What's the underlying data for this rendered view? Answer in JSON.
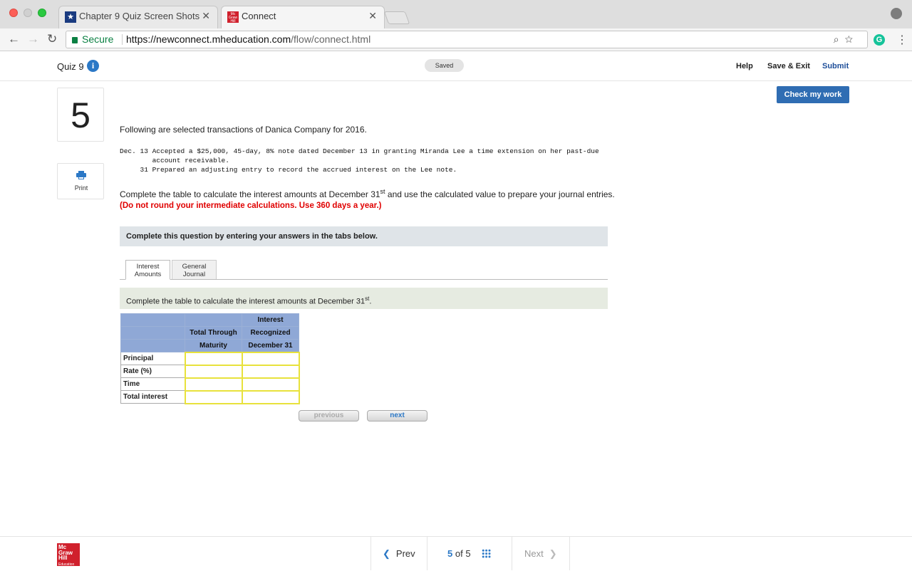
{
  "browser": {
    "tabs": [
      {
        "title": "Chapter 9 Quiz Screen Shots"
      },
      {
        "title": "Connect"
      }
    ],
    "secure_label": "Secure",
    "url_host": "https://newconnect.mheducation.com",
    "url_path": "/flow/connect.html",
    "extension_letter": "G"
  },
  "header": {
    "quiz_title": "Quiz 9",
    "saved_label": "Saved",
    "help": "Help",
    "save_exit": "Save & Exit",
    "submit": "Submit",
    "check_work": "Check my work"
  },
  "question": {
    "number": "5",
    "print_label": "Print",
    "intro": "Following are selected transactions of Danica Company for 2016.",
    "transactions": "Dec. 13 Accepted a $25,000, 45-day, 8% note dated December 13 in granting Miranda Lee a time extension on her past-due\n        account receivable.\n     31 Prepared an adjusting entry to record the accrued interest on the Lee note.",
    "instruction_pre": "Complete the table to calculate the interest amounts at December 31",
    "instruction_sup": "st",
    "instruction_post": " and use the calculated value to prepare your journal entries.",
    "warning": "(Do not round your intermediate calculations. Use 360 days a year.)",
    "banner": "Complete this question by entering your answers in the tabs below.",
    "tabs": [
      {
        "line1": "Interest",
        "line2": "Amounts"
      },
      {
        "line1": "General",
        "line2": "Journal"
      }
    ],
    "sub_banner_pre": "Complete the table to calculate the interest amounts at December 31",
    "sub_banner_sup": "st",
    "sub_banner_post": "."
  },
  "table": {
    "headers": {
      "col1": [
        "",
        "Total Through",
        "Maturity"
      ],
      "col2": [
        "Interest",
        "Recognized",
        "December 31"
      ]
    },
    "rows": [
      "Principal",
      "Rate (%)",
      "Time",
      "Total interest"
    ]
  },
  "pager": {
    "previous": "previous",
    "next": "next"
  },
  "footer": {
    "logo_lines": [
      "Mc",
      "Graw",
      "Hill",
      "Education"
    ],
    "prev": "Prev",
    "current": "5",
    "of": "of",
    "total": "5",
    "next": "Next"
  }
}
